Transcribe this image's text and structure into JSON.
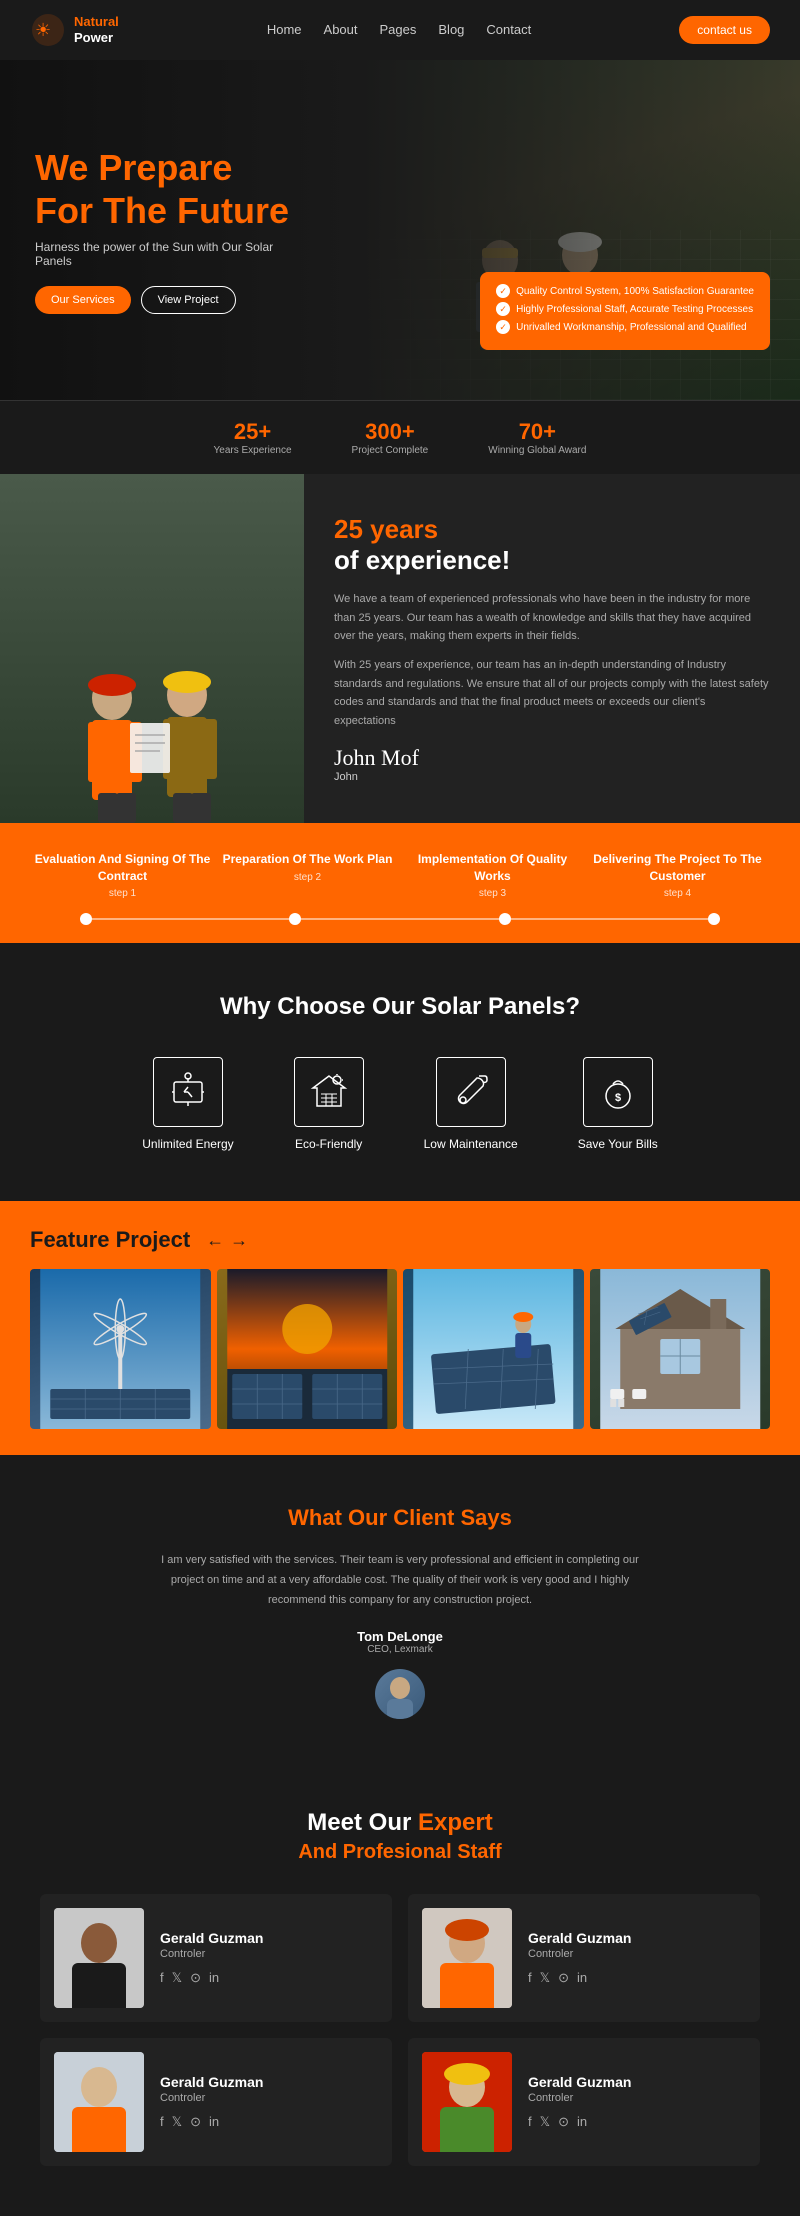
{
  "brand": {
    "name": "Natural Power",
    "tagline": "Natural Power"
  },
  "nav": {
    "links": [
      "Home",
      "About",
      "Pages",
      "Blog",
      "Contact"
    ],
    "contact_btn": "contact us"
  },
  "hero": {
    "heading_line1": "We Prepare",
    "heading_line2": "For The ",
    "heading_highlight": "Future",
    "subheading": "Harness the power of the Sun with Our Solar Panels",
    "btn_services": "Our Services",
    "btn_project": "View Project",
    "checklist": [
      "Quality Control System, 100% Satisfaction Guarantee",
      "Highly Professional Staff, Accurate Testing Processes",
      "Unrivalled Workmanship, Professional and Qualified"
    ]
  },
  "stats": [
    {
      "num": "25+",
      "label": "Years Experience"
    },
    {
      "num": "300+",
      "label": "Project Complete"
    },
    {
      "num": "70+",
      "label": "Winning Global Award"
    }
  ],
  "experience": {
    "years": "25 years",
    "subtitle": "of experience!",
    "para1": "We have a team of experienced professionals who have been in the industry for more than 25 years. Our team has a wealth of knowledge and skills that they have acquired over the years, making them experts in their fields.",
    "para2": "With 25 years of experience, our team has an in-depth understanding of Industry standards and regulations. We ensure that all of our projects comply with the latest safety codes and standards and that the final product meets or exceeds our client's expectations",
    "signature": "John Mof",
    "signer": "John"
  },
  "steps": [
    {
      "title": "Evaluation And Signing Of The Contract",
      "num": "step 1"
    },
    {
      "title": "Preparation Of The Work Plan",
      "num": "step 2"
    },
    {
      "title": "Implementation Of Quality Works",
      "num": "step 3"
    },
    {
      "title": "Delivering The Project To The Customer",
      "num": "step 4"
    }
  ],
  "why": {
    "heading": "Why Choose Our Solar Panels?",
    "items": [
      {
        "icon": "⚡",
        "label": "Unlimited Energy"
      },
      {
        "icon": "🏠",
        "label": "Eco-Friendly"
      },
      {
        "icon": "🔧",
        "label": "Low Maintenance"
      },
      {
        "icon": "💰",
        "label": "Save Your Bills"
      }
    ]
  },
  "feature": {
    "title": "Feature Project",
    "arrows": [
      "←",
      "→"
    ]
  },
  "testimonial": {
    "heading": "What Our Client Says",
    "text": "I am very satisfied with the services. Their team is very professional and efficient in completing our project on time and at a very affordable cost. The quality of their work is very good and I highly recommend this company for any construction project.",
    "name": "Tom DeLonge",
    "role": "CEO, Lexmark"
  },
  "team": {
    "heading_line1": "Meet Our Expert",
    "heading_highlight": "Expert",
    "heading_line2": "And Profesional Staff",
    "heading_highlight2": "Profesional Staff",
    "members": [
      {
        "name": "Gerald Guzman",
        "role": "Controler",
        "photo_class": "team-photo-1"
      },
      {
        "name": "Gerald Guzman",
        "role": "Controler",
        "photo_class": "team-photo-2"
      },
      {
        "name": "Gerald Guzman",
        "role": "Controler",
        "photo_class": "team-photo-3"
      },
      {
        "name": "Gerald Guzman",
        "role": "Controler",
        "photo_class": "team-photo-4"
      }
    ],
    "social_icons": [
      "f",
      "𝕏",
      "⌂",
      "in"
    ]
  }
}
